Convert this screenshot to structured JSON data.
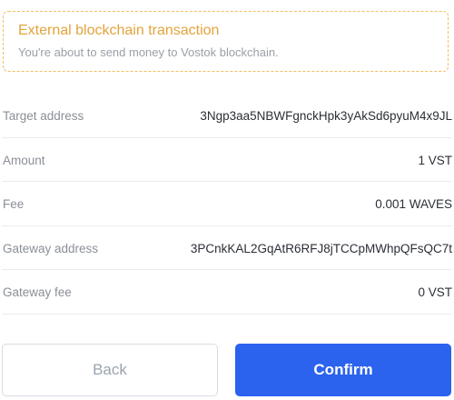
{
  "notice": {
    "title": "External blockchain transaction",
    "subtitle": "You're about to send money to Vostok blockchain."
  },
  "details": [
    {
      "label": "Target address",
      "value": "3Ngp3aa5NBWFgnckHpk3yAkSd6pyuM4x9JL"
    },
    {
      "label": "Amount",
      "value": "1 VST"
    },
    {
      "label": "Fee",
      "value": "0.001 WAVES"
    },
    {
      "label": "Gateway address",
      "value": "3PCnkKAL2GqAtR6RFJ8jTCCpMWhpQFsQC7t"
    },
    {
      "label": "Gateway fee",
      "value": "0 VST"
    }
  ],
  "buttons": {
    "back_label": "Back",
    "confirm_label": "Confirm"
  },
  "colors": {
    "accent": "#2b63ef",
    "warning": "#e3a43c"
  }
}
